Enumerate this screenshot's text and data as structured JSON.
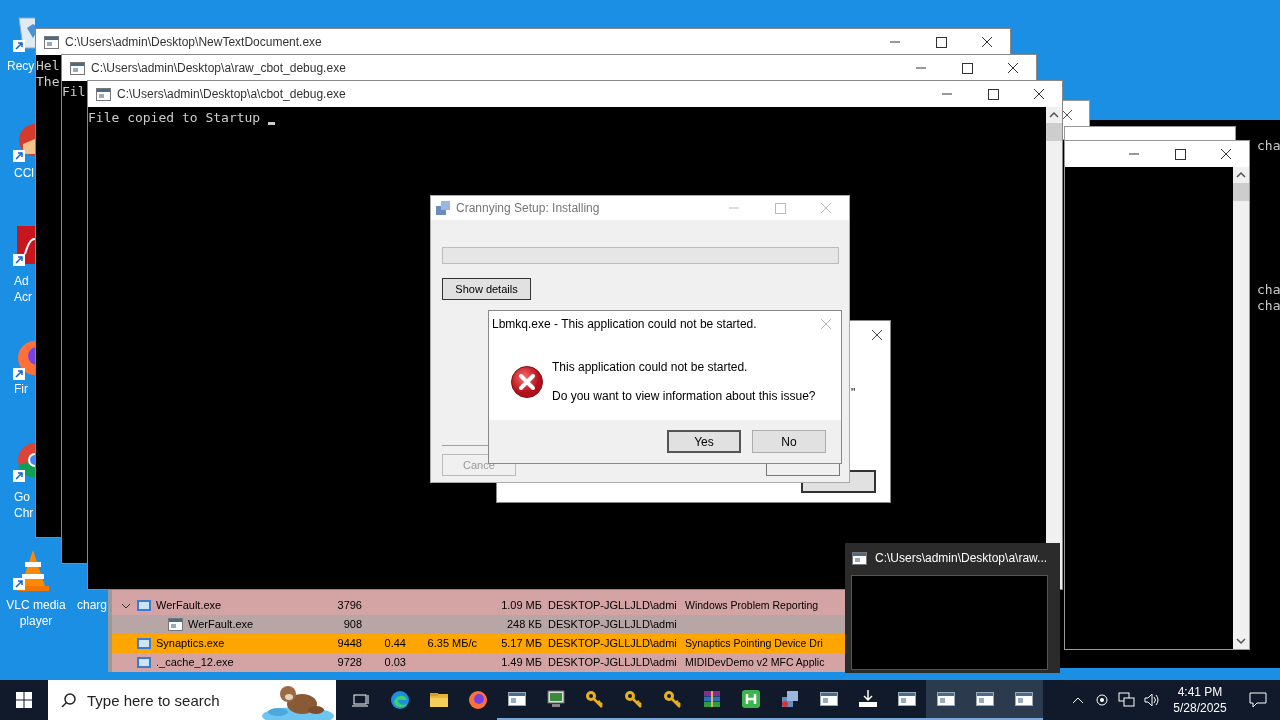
{
  "desktop_icons": [
    {
      "kind": "recycle",
      "lines": [
        "Recy"
      ]
    },
    {
      "kind": "ccleaner",
      "lines": [
        "CCl"
      ]
    },
    {
      "kind": "acrobat",
      "lines": [
        "Ad",
        "Acr"
      ]
    },
    {
      "kind": "firefox",
      "lines": [
        "Fir"
      ]
    },
    {
      "kind": "chrome",
      "lines": [
        "Go",
        "Chr"
      ]
    },
    {
      "kind": "vlc",
      "lines": [
        "VLC media",
        "player"
      ]
    },
    {
      "kind": "hidden",
      "lines": [
        "charg"
      ]
    }
  ],
  "background_console": {
    "blocks": [
      [
        "cha"
      ],
      [
        "cha",
        "cha"
      ]
    ]
  },
  "windows": [
    {
      "title": "C:\\Users\\admin\\Desktop\\NewTextDocument.exe",
      "lines": [
        "Hel",
        "The"
      ]
    },
    {
      "title": "C:\\Users\\admin\\Desktop\\a\\raw_cbot_debug.exe",
      "lines": [
        "Fil"
      ]
    },
    {
      "title": "C:\\Users\\admin\\Desktop\\a\\cbot_debug.exe",
      "lines": [
        "File copied to Startup"
      ],
      "cursor": true
    }
  ],
  "task_manager": {
    "rows": [
      {
        "name": "WerFault.exe",
        "pid": "3796",
        "memory": "1.09 МБ",
        "user": "DESKTOP-JGLLJLD\\admi",
        "description": "Windows Problem Reporting",
        "color": "#d4a4a4",
        "expanded": true,
        "children": [
          {
            "name": "WerFault.exe",
            "pid": "908",
            "memory": "248 КБ",
            "user": "DESKTOP-JGLLJLD\\admi",
            "color": "#b8a6a6"
          }
        ]
      },
      {
        "name": "Synaptics.exe",
        "pid": "9448",
        "cpu": "0.44",
        "io": "6.35 МБ/с",
        "memory": "5.17 МБ",
        "user": "DESKTOP-JGLLJLD\\admi",
        "description": "Synaptics Pointing Device Dri",
        "color": "#ffa500"
      },
      {
        "name": "._cache_12.exe",
        "pid": "9728",
        "cpu": "0.03",
        "memory": "1.49 МБ",
        "user": "DESKTOP-JGLLJLD\\admi",
        "description": "MIDIDevDemo v2 MFC Applic",
        "color": "#d4a4a4"
      }
    ]
  },
  "setup_dialog": {
    "title": "Crannying Setup: Installing",
    "progress": {
      "level": 0
    },
    "details_button": "Show details",
    "cancel_button": "Cance"
  },
  "back_dialog": {
    "fragment": "\""
  },
  "error_dialog": {
    "title": "Lbmkq.exe - This application could not be started.",
    "message": "This application could not be started.",
    "question": "Do you want to view information about this issue?",
    "buttons": [
      "Yes",
      "No"
    ]
  },
  "thumbnail": {
    "title": "C:\\Users\\admin\\Desktop\\a\\raw..."
  },
  "taskbar": {
    "search_placeholder": "Type here to search",
    "apps": [
      {
        "kind": "taskview",
        "active": false
      },
      {
        "kind": "edge",
        "active": false
      },
      {
        "kind": "folder",
        "active": false
      },
      {
        "kind": "firefox",
        "active": false
      },
      {
        "kind": "console",
        "active": true
      },
      {
        "kind": "monitor",
        "active": true
      },
      {
        "kind": "key",
        "active": true
      },
      {
        "kind": "key",
        "active": true
      },
      {
        "kind": "key",
        "active": true
      },
      {
        "kind": "archive",
        "active": true
      },
      {
        "kind": "h",
        "active": true
      },
      {
        "kind": "installer",
        "active": true
      },
      {
        "kind": "console",
        "active": true
      },
      {
        "kind": "download",
        "active": true
      },
      {
        "kind": "console",
        "active": true
      },
      {
        "kind": "console",
        "active": true
      },
      {
        "kind": "console",
        "active": true
      },
      {
        "kind": "console",
        "active": true
      }
    ],
    "time": "4:41 PM",
    "date": "5/28/2025"
  }
}
